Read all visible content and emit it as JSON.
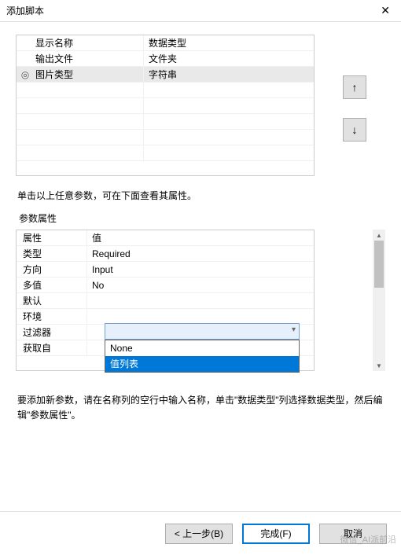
{
  "window": {
    "title": "添加脚本",
    "close": "✕"
  },
  "grid1": {
    "rows": [
      {
        "marker": "",
        "name": "显示名称",
        "type": "数据类型"
      },
      {
        "marker": "",
        "name": "输出文件",
        "type": "文件夹"
      },
      {
        "marker": "◎",
        "name": "图片类型",
        "type": "字符串"
      }
    ]
  },
  "updown": {
    "up": "↑",
    "down": "↓"
  },
  "hint1": "单击以上任意参数，可在下面查看其属性。",
  "group": "参数属性",
  "grid2": {
    "rows": [
      {
        "k": "属性",
        "v": "值"
      },
      {
        "k": "类型",
        "v": "Required"
      },
      {
        "k": "方向",
        "v": "Input"
      },
      {
        "k": "多值",
        "v": "No"
      },
      {
        "k": "默认",
        "v": ""
      },
      {
        "k": "环境",
        "v": ""
      },
      {
        "k": "过滤器",
        "v": ""
      },
      {
        "k": "获取自",
        "v": ""
      }
    ]
  },
  "dropdown": {
    "options": [
      {
        "label": "None",
        "selected": false
      },
      {
        "label": "值列表",
        "selected": true
      }
    ]
  },
  "hint2": "要添加新参数，请在名称列的空行中输入名称，单击\"数据类型\"列选择数据类型，然后编辑\"参数属性\"。",
  "footer": {
    "back": "< 上一步(B)",
    "finish": "完成(F)",
    "cancel": "取消"
  },
  "watermark": "微信_AI派前沿"
}
